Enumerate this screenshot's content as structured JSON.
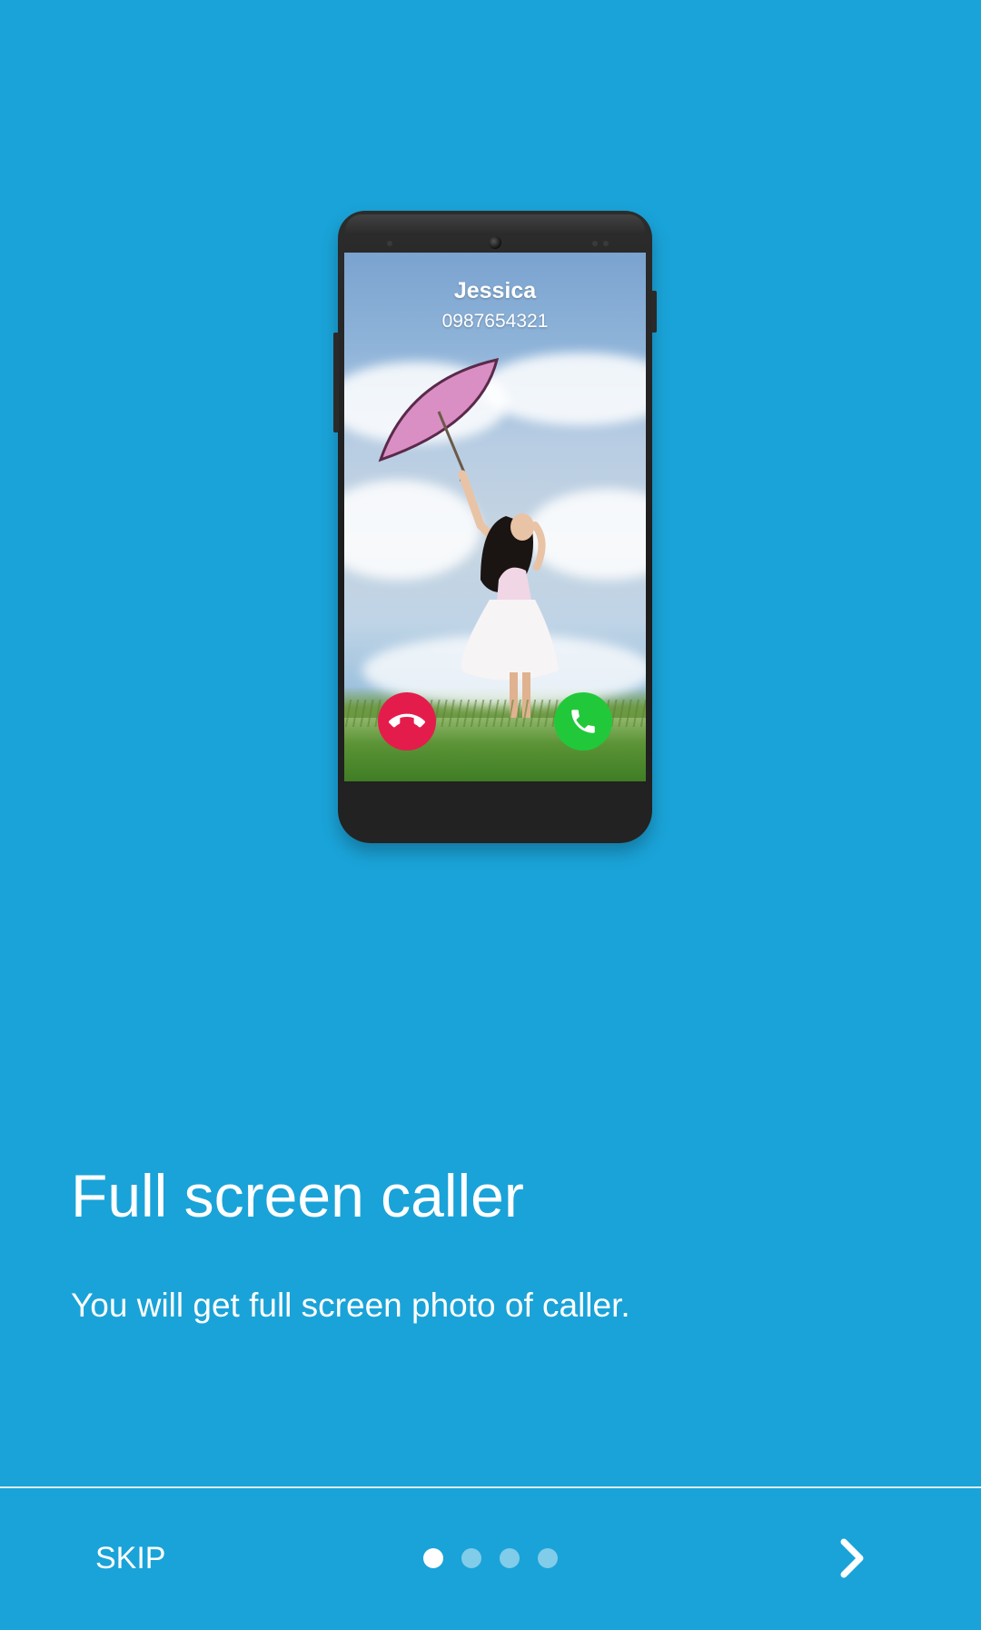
{
  "illustration": {
    "caller_name": "Jessica",
    "caller_number": "0987654321",
    "decline_icon": "phone-hangup-icon",
    "accept_icon": "phone-icon",
    "colors": {
      "decline": "#e41c4c",
      "accept": "#21c93a"
    }
  },
  "onboarding": {
    "title": "Full screen caller",
    "description": "You will get full screen photo of caller."
  },
  "footer": {
    "skip_label": "SKIP",
    "next_icon": "chevron-right-icon",
    "pages": {
      "total": 4,
      "current": 1
    }
  },
  "colors": {
    "background": "#1aa3d8",
    "text": "#ffffff"
  }
}
